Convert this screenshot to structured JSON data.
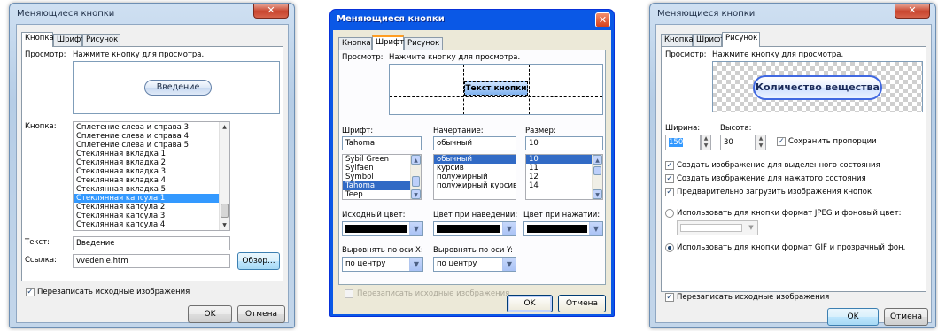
{
  "title": "Меняющиеся кнопки",
  "close_glyph": "✕",
  "tabs": [
    "Кнопка",
    "Шрифт",
    "Рисунок"
  ],
  "preview_label": "Просмотр:",
  "preview_hint": "Нажмите кнопку для просмотра.",
  "ok": "OK",
  "cancel": "Отмена",
  "overwrite": "Перезаписать исходные изображения",
  "button_tab": {
    "preview_button_text": "Введение",
    "button_label": "Кнопка:",
    "button_list": [
      "Сплетение слева и справа 3",
      "Сплетение слева и справа 4",
      "Сплетение слева и справа 5",
      "Стеклянная вкладка 1",
      "Стеклянная вкладка 2",
      "Стеклянная вкладка 3",
      "Стеклянная вкладка 4",
      "Стеклянная вкладка 5",
      "Стеклянная капсула 1",
      "Стеклянная капсула 2",
      "Стеклянная капсула 3",
      "Стеклянная капсула 4"
    ],
    "text_label": "Текст:",
    "text_value": "Введение",
    "link_label": "Ссылка:",
    "link_value": "vvedenie.htm",
    "browse": "Обзор..."
  },
  "font_tab": {
    "preview_button_text": "Текст кнопки",
    "font_label": "Шрифт:",
    "font_value": "Tahoma",
    "font_list": [
      "Sybil Green",
      "Sylfaen",
      "Symbol",
      "Tahoma",
      "Teep"
    ],
    "style_label": "Начертание:",
    "style_value": "обычный",
    "style_list": [
      "обычный",
      "курсив",
      "полужирный",
      "полужирный курсив"
    ],
    "size_label": "Размер:",
    "size_value": "10",
    "size_list": [
      "10",
      "11",
      "12",
      "14"
    ],
    "color_src_label": "Исходный цвет:",
    "color_hover_label": "Цвет при наведении:",
    "color_press_label": "Цвет при нажатии:",
    "align_x_label": "Выровнять по оси X:",
    "align_x_value": "по центру",
    "align_y_label": "Выровнять по оси Y:",
    "align_y_value": "по центру"
  },
  "image_tab": {
    "preview_button_text": "Количество вещества",
    "width_label": "Ширина:",
    "width_value": "150",
    "height_label": "Высота:",
    "height_value": "30",
    "keep_ratio": "Сохранить пропорции",
    "opt_selected": "Создать изображение для выделенного состояния",
    "opt_pressed": "Создать изображение для нажатого состояния",
    "opt_preload": "Предварительно загрузить изображения кнопок",
    "radio_jpeg": "Использовать для кнопки формат JPEG и фоновый цвет:",
    "radio_gif": "Использовать для кнопки формат GIF и прозрачный фон."
  }
}
